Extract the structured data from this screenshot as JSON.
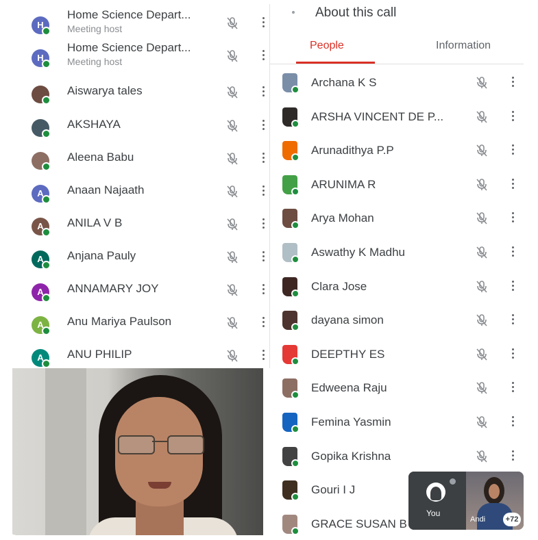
{
  "left_list": [
    {
      "name": "Home Science Depart...",
      "sub": "Meeting host",
      "initial": "H",
      "color": "#5c6bc0"
    },
    {
      "name": "Home Science Depart...",
      "sub": "Meeting host",
      "initial": "H",
      "color": "#5c6bc0"
    },
    {
      "name": "Aiswarya tales",
      "sub": "",
      "initial": "",
      "color": "#6d4c41"
    },
    {
      "name": "AKSHAYA",
      "sub": "",
      "initial": "",
      "color": "#455a64"
    },
    {
      "name": "Aleena Babu",
      "sub": "",
      "initial": "",
      "color": "#8d6e63"
    },
    {
      "name": "Anaan Najaath",
      "sub": "",
      "initial": "A",
      "color": "#5c6bc0"
    },
    {
      "name": "ANILA V B",
      "sub": "",
      "initial": "A",
      "color": "#795548"
    },
    {
      "name": "Anjana Pauly",
      "sub": "",
      "initial": "A",
      "color": "#00695c"
    },
    {
      "name": "ANNAMARY JOY",
      "sub": "",
      "initial": "A",
      "color": "#8e24aa"
    },
    {
      "name": "Anu Mariya Paulson",
      "sub": "",
      "initial": "A",
      "color": "#7cb342"
    },
    {
      "name": "ANU PHILIP",
      "sub": "",
      "initial": "A",
      "color": "#00897b"
    }
  ],
  "right_panel": {
    "title": "About this call",
    "tabs": [
      "People",
      "Information"
    ],
    "participants": [
      {
        "name": "Archana K S",
        "color": "#7a8ea8"
      },
      {
        "name": "ARSHA VINCENT DE P...",
        "color": "#2e2a28"
      },
      {
        "name": "Arunadithya P.P",
        "color": "#ef6c00"
      },
      {
        "name": "ARUNIMA R",
        "color": "#43a047"
      },
      {
        "name": "Arya Mohan",
        "color": "#6d4c41"
      },
      {
        "name": "Aswathy K Madhu",
        "color": "#b0bec5"
      },
      {
        "name": "Clara Jose",
        "color": "#3e2723"
      },
      {
        "name": "dayana simon",
        "color": "#4e342e"
      },
      {
        "name": "DEEPTHY ES",
        "color": "#e53935"
      },
      {
        "name": "Edweena Raju",
        "color": "#8d6e63"
      },
      {
        "name": "Femina Yasmin",
        "color": "#1565c0"
      },
      {
        "name": "Gopika Krishna",
        "color": "#424242"
      },
      {
        "name": "Gouri I J",
        "color": "#3e2f20"
      },
      {
        "name": "GRACE SUSAN B",
        "color": "#a1887f"
      }
    ]
  },
  "self_view": {
    "you_label": "You",
    "other_label": "Andi",
    "count": "+72"
  }
}
